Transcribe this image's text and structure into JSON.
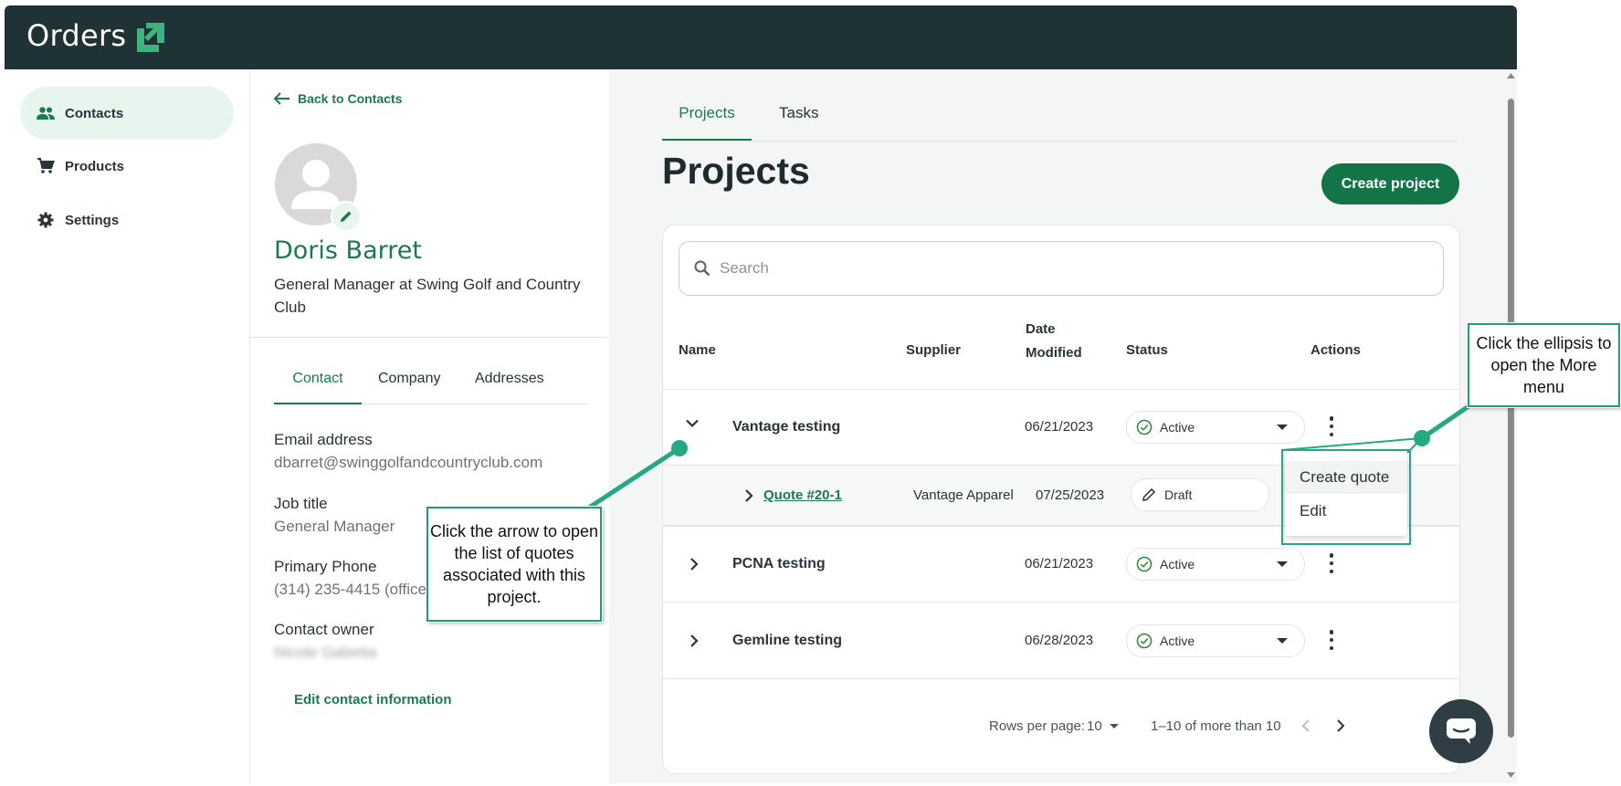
{
  "app": {
    "title": "Orders"
  },
  "colors": {
    "topbar": "#1f3235",
    "accent": "#1b7a4e",
    "button": "#127447",
    "callout_border": "#1f9c78"
  },
  "sidebar": {
    "items": [
      {
        "label": "Contacts",
        "icon": "people-icon",
        "active": true
      },
      {
        "label": "Products",
        "icon": "cart-icon",
        "active": false
      },
      {
        "label": "Settings",
        "icon": "gear-icon",
        "active": false
      }
    ]
  },
  "contact": {
    "back_label": "Back to Contacts",
    "name": "Doris Barret",
    "role": "General Manager at Swing Golf and Country Club",
    "tabs": [
      "Contact",
      "Company",
      "Addresses"
    ],
    "active_tab": "Contact",
    "fields": {
      "email_label": "Email address",
      "email_value": "dbarret@swinggolfandcountryclub.com",
      "job_label": "Job title",
      "job_value": "General Manager",
      "phone_label": "Primary Phone",
      "phone_value": "(314) 235-4415 (office)",
      "owner_label": "Contact owner",
      "owner_value": "Nicole Gabetta"
    },
    "edit_label": "Edit contact information"
  },
  "main": {
    "tabs": [
      "Projects",
      "Tasks"
    ],
    "active_tab": "Projects",
    "title": "Projects",
    "create_button": "Create project",
    "search_placeholder": "Search",
    "columns": {
      "name": "Name",
      "supplier": "Supplier",
      "date_line1": "Date",
      "date_line2": "Modified",
      "status": "Status",
      "actions": "Actions"
    },
    "rows": [
      {
        "name": "Vantage testing",
        "date": "06/21/2023",
        "status": "Active",
        "expanded": true
      },
      {
        "name": "PCNA testing",
        "date": "06/21/2023",
        "status": "Active",
        "expanded": false
      },
      {
        "name": "Gemline testing",
        "date": "06/28/2023",
        "status": "Active",
        "expanded": false
      }
    ],
    "subrow": {
      "quote": "Quote #20-1",
      "supplier": "Vantage Apparel",
      "date": "07/25/2023",
      "status": "Draft"
    },
    "menu": {
      "items": [
        "Create quote",
        "Edit"
      ]
    },
    "pagination": {
      "rows_label": "Rows per page:",
      "rows_value": "10",
      "range": "1–10 of more than 10"
    }
  },
  "callouts": {
    "arrow": "Click the arrow to open the list of quotes associated with this project.",
    "ellipsis": "Click the ellipsis to open the More menu"
  }
}
